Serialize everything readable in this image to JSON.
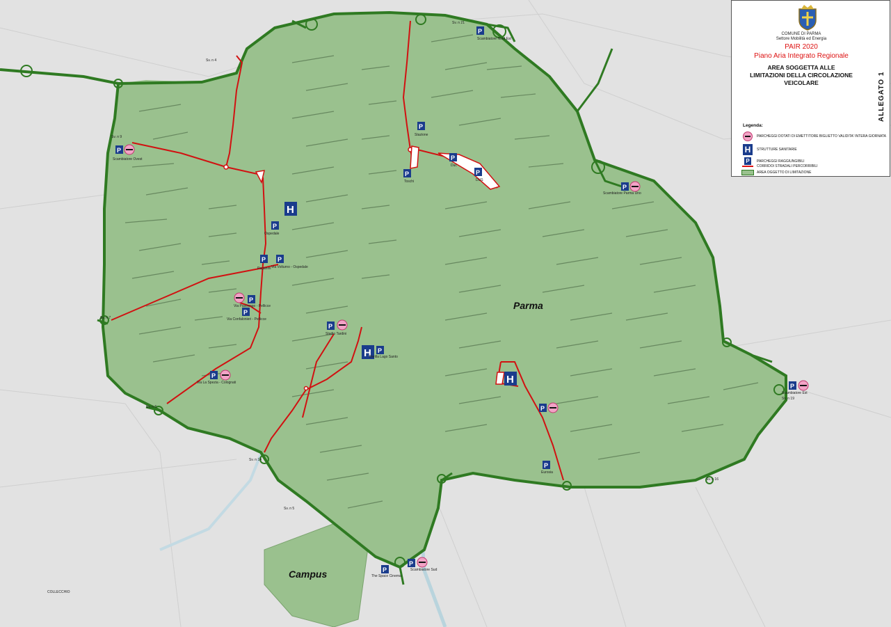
{
  "header": {
    "comune": "COMUNE DI PARMA",
    "settore": "Settore Mobilità ed Energia",
    "pair": "PAIR 2020",
    "piano": "Piano Aria Integrato Regionale",
    "area_title_1": "AREA SOGGETTA ALLE",
    "area_title_2": "LIMITAZIONI DELLA CIRCOLAZIONE",
    "area_title_3": "VEICOLARE",
    "allegato": "ALLEGATO 1"
  },
  "legend": {
    "title": "Legenda:",
    "items": [
      {
        "icon": "no-entry-icon",
        "label": "PARCHEGGI DOTATI DI EMETTITORE BIGLIETTO VALIDITA' INTERA GIORNATA"
      },
      {
        "icon": "hospital-icon",
        "label": "STRUTTURE SANITARIE"
      },
      {
        "icon": "parking-icon",
        "label": "PARCHEGGI RAGGIUNGIBILI"
      },
      {
        "icon": "red-line",
        "label": "CORRIDOI STRADALI PERCORRIBILI"
      },
      {
        "icon": "green-area",
        "label": "AREA OGGETTO DI LIMITAZIONE"
      }
    ]
  },
  "map_labels": {
    "city": "Parma",
    "campus": "Campus",
    "collecchio": "COLLECCHIO"
  },
  "parkings": [
    "Stazione",
    "Toschi",
    "Duc",
    "DUS",
    "Scambiatore Ovest",
    "Ospedale",
    "Paganini",
    "Via Volturno - Ospedale",
    "Via Pastrengo - Pellicce",
    "Via Confalonieri - Pellicce",
    "Via La Spezia - Colognati",
    "Stadio Tardini",
    "Barilla Lago Santo",
    "Scambiatore Nord Est",
    "Scambiatore Est",
    "Scambiatore Sud",
    "The Space Cinema",
    "Eurosia",
    "Scambiatore Parma Uno"
  ],
  "road_labels": [
    "Sv. n 9",
    "Sv. n 19",
    "Sv. n 7",
    "Sv. n 6",
    "Sv. n 14",
    "Sv. n 5",
    "Sv. n 4",
    "Sv. n 16",
    "Sv. n 21"
  ],
  "colors": {
    "zone_fill": "#9ac18e",
    "ring_road": "#2f7a22",
    "corridor": "#d11111",
    "parking": "#1a3c8c",
    "ban": "#f2a3c6"
  }
}
